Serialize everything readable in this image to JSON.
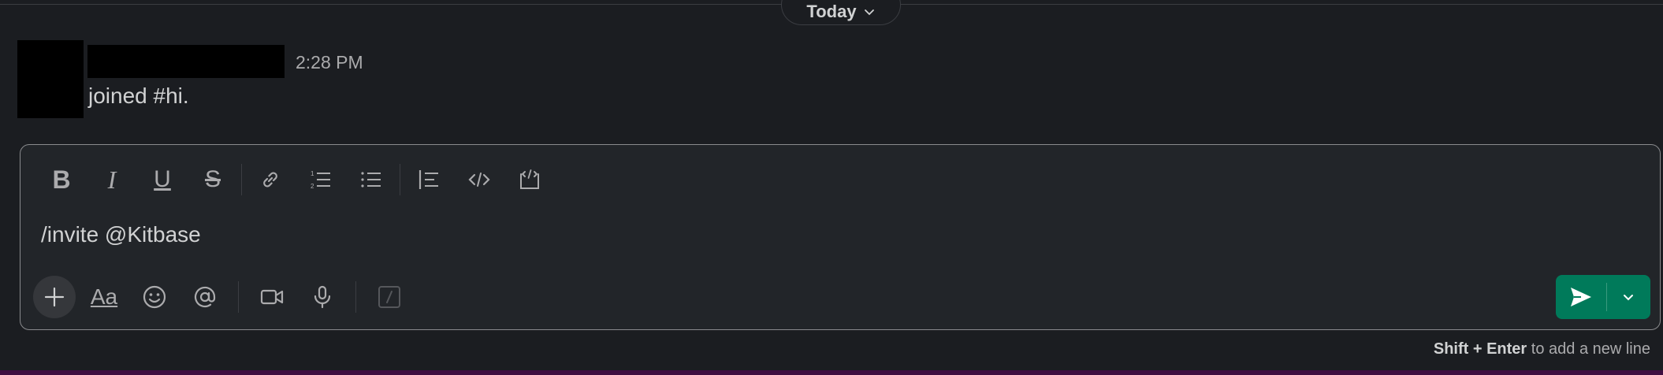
{
  "divider": {
    "date_label": "Today"
  },
  "message": {
    "timestamp": "2:28 PM",
    "text": "joined #hi."
  },
  "composer": {
    "value": "/invite @Kitbase",
    "formatting": {
      "bold": "B",
      "italic": "I",
      "underline": "U",
      "strikethrough": "S"
    },
    "text_format_label": "Aa",
    "hint": {
      "keys": "Shift + Enter",
      "rest": " to add a new line"
    }
  },
  "colors": {
    "background": "#1b1d21",
    "composer_bg": "#222529",
    "send_button": "#007a5a",
    "bottom_strip": "#3f0e40"
  },
  "icons": [
    "bold-icon",
    "italic-icon",
    "underline-icon",
    "strikethrough-icon",
    "link-icon",
    "ordered-list-icon",
    "bulleted-list-icon",
    "blockquote-icon",
    "code-icon",
    "code-block-icon",
    "plus-icon",
    "text-format-icon",
    "emoji-icon",
    "mention-icon",
    "video-icon",
    "microphone-icon",
    "slash-command-icon",
    "send-icon",
    "chevron-down-icon"
  ]
}
